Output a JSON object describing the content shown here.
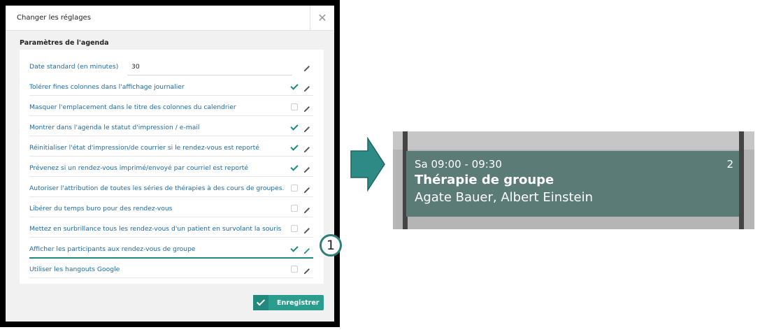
{
  "dialog": {
    "title": "Changer les réglages",
    "close_icon": "close-icon",
    "section_title": "Paramètres de l'agenda",
    "rows": [
      {
        "label": "Date standard (en minutes)",
        "value": "30",
        "type": "text"
      },
      {
        "label": "Tolérer fines colonnes dans l'affichage journalier",
        "checked": true,
        "type": "checkbox"
      },
      {
        "label": "Masquer l'emplacement dans le titre des colonnes du calendrier",
        "checked": false,
        "type": "checkbox"
      },
      {
        "label": "Montrer dans l'agenda le statut d'impression / e-mail",
        "checked": true,
        "type": "checkbox"
      },
      {
        "label": "Réinitialiser l'état d'impression/de courrier si le rendez-vous est reporté",
        "checked": true,
        "type": "checkbox"
      },
      {
        "label": "Prévenez si un rendez-vous imprimé/envoyé par courriel est reporté",
        "checked": true,
        "type": "checkbox"
      },
      {
        "label": "Autoriser l'attribution de toutes les séries de thérapies à des cours de groupes.",
        "checked": false,
        "type": "checkbox"
      },
      {
        "label": "Libérer du temps buro pour des rendez-vous",
        "checked": false,
        "type": "checkbox"
      },
      {
        "label": "Mettez en surbrillance tous les rendez-vous d'un patient en survolant la souris",
        "checked": false,
        "type": "checkbox"
      },
      {
        "label": "Afficher les participants aux rendez-vous de groupe",
        "checked": true,
        "type": "checkbox",
        "active": true
      },
      {
        "label": "Utiliser les hangouts Google",
        "checked": false,
        "type": "checkbox"
      }
    ],
    "save_label": "Enregistrer"
  },
  "callout": {
    "number": "1"
  },
  "event": {
    "time": "Sa 09:00 - 09:30",
    "title": "Thérapie de groupe",
    "participants": "Agate Bauer, Albert Einstein",
    "count": "2"
  },
  "colors": {
    "accent": "#2a9d8f",
    "label_blue": "#1e6aa8",
    "event_bg": "#5a7b76",
    "arrow": "#2e8a84"
  }
}
